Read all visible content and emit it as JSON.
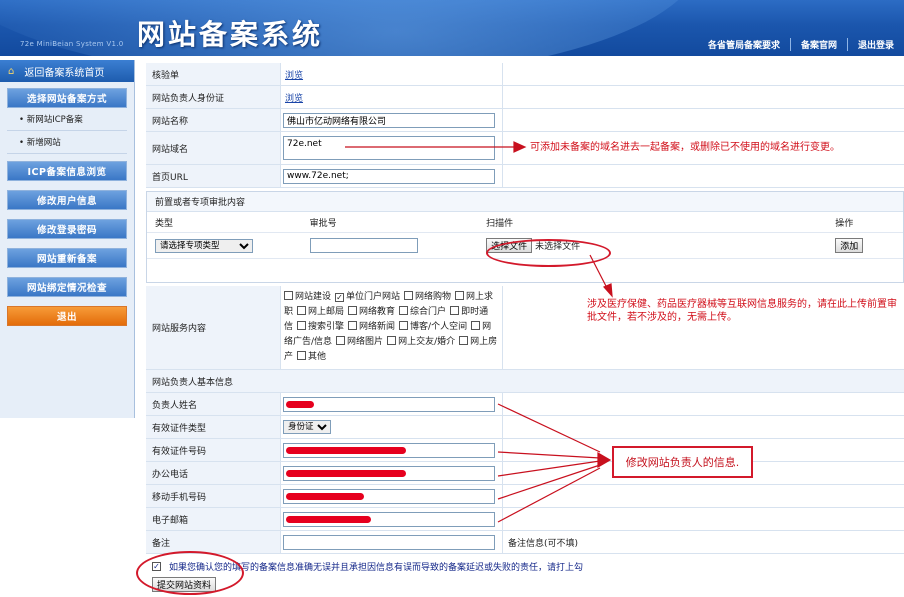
{
  "header": {
    "subtitle": "72e MiniBeian System V1.0",
    "title": "网站备案系统",
    "nav": [
      "各省管局备案要求",
      "备案官网",
      "退出登录"
    ]
  },
  "sidebar": {
    "home": "返回备案系统首页",
    "items": [
      {
        "type": "button",
        "label": "选择网站备案方式"
      },
      {
        "type": "sub",
        "label": "• 新网站ICP备案"
      },
      {
        "type": "sub",
        "label": "• 新增网站"
      },
      {
        "type": "button",
        "label": "ICP备案信息浏览"
      },
      {
        "type": "button",
        "label": "修改用户信息"
      },
      {
        "type": "button",
        "label": "修改登录密码"
      },
      {
        "type": "button",
        "label": "网站重新备案"
      },
      {
        "type": "button",
        "label": "网站绑定情况检查"
      },
      {
        "type": "exit",
        "label": "退出"
      }
    ]
  },
  "form": {
    "verify": {
      "label": "核验单",
      "link": "浏览"
    },
    "owner_id": {
      "label": "网站负责人身份证",
      "link": "浏览"
    },
    "site_name": {
      "label": "网站名称",
      "value": "佛山市亿动网络有限公司"
    },
    "domain": {
      "label": "网站域名",
      "value": "72e.net"
    },
    "homepage": {
      "label": "首页URL",
      "value": "www.72e.net;"
    },
    "pre": {
      "title": "前置或者专项审批内容",
      "cols": [
        "类型",
        "审批号",
        "扫描件",
        "操作"
      ],
      "type_value": "请选择专项类型",
      "file_button": "选择文件",
      "file_status": "未选择文件",
      "add_button": "添加"
    },
    "service": {
      "label": "网站服务内容",
      "options": [
        {
          "text": "网站建设",
          "checked": false
        },
        {
          "text": "单位门户网站",
          "checked": true
        },
        {
          "text": "网络购物",
          "checked": false
        },
        {
          "text": "网上求职",
          "checked": false
        },
        {
          "text": "网上邮局",
          "checked": false
        },
        {
          "text": "网络教育",
          "checked": false
        },
        {
          "text": "综合门户",
          "checked": false
        },
        {
          "text": "即时通信",
          "checked": false
        },
        {
          "text": "搜索引擎",
          "checked": false
        },
        {
          "text": "网络新闻",
          "checked": false
        },
        {
          "text": "博客/个人空间",
          "checked": false
        },
        {
          "text": "网络广告/信息",
          "checked": false
        },
        {
          "text": "网络图片",
          "checked": false
        },
        {
          "text": "网上交友/婚介",
          "checked": false
        },
        {
          "text": "网上房产",
          "checked": false
        },
        {
          "text": "其他",
          "checked": false
        }
      ]
    },
    "owner_section": "网站负责人基本信息",
    "owner_name": {
      "label": "负责人姓名"
    },
    "id_type": {
      "label": "有效证件类型",
      "value": "身份证"
    },
    "id_number": {
      "label": "有效证件号码"
    },
    "office_phone": {
      "label": "办公电话"
    },
    "mobile": {
      "label": "移动手机号码"
    },
    "email": {
      "label": "电子邮箱"
    },
    "remark": {
      "label": "备注",
      "hint": "备注信息(可不填)"
    },
    "confirm_text": "如果您确认您的填写的备案信息准确无误并且承担因信息有误而导致的备案延迟或失败的责任，请打上勾",
    "submit": "提交网站资料"
  },
  "annotations": {
    "domain_note": "可添加未备案的域名进去一起备案，或删除已不使用的域名进行变更。",
    "upload_note": "涉及医疗保健、药品医疗器械等互联网信息服务的，请在此上传前置审批文件，若不涉及的，无需上传。",
    "owner_note": "修改网站负责人的信息."
  },
  "colors": {
    "header": "#1b56ad",
    "annotation": "#d3192b",
    "exit": "#e36c0a"
  }
}
